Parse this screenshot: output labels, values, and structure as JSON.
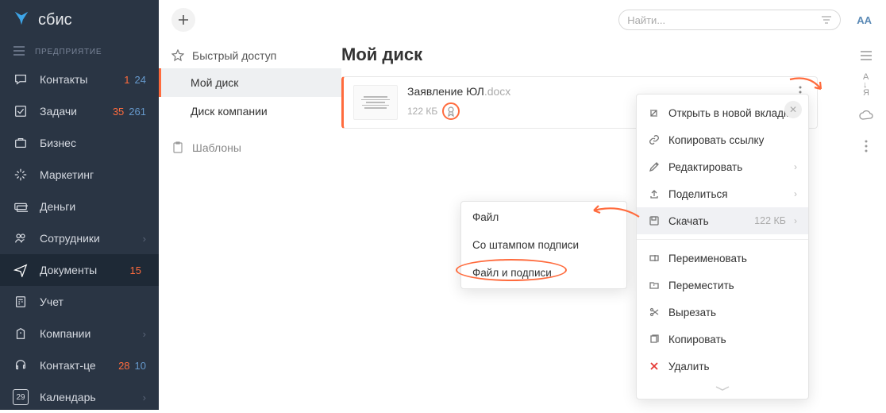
{
  "brand": "сбис",
  "enterprise": "ПРЕДПРИЯТИЕ",
  "nav": [
    {
      "label": "Контакты",
      "b1": "1",
      "b2": "24"
    },
    {
      "label": "Задачи",
      "b1": "35",
      "b2": "261"
    },
    {
      "label": "Бизнес"
    },
    {
      "label": "Маркетинг"
    },
    {
      "label": "Деньги"
    },
    {
      "label": "Сотрудники",
      "chev": true
    },
    {
      "label": "Документы",
      "b1": "15",
      "active": true
    },
    {
      "label": "Учет"
    },
    {
      "label": "Компании",
      "chev": true
    },
    {
      "label": "Контакт-це",
      "b1": "28",
      "b2": "10"
    },
    {
      "label": "Календарь",
      "chev": true
    }
  ],
  "search_placeholder": "Найти...",
  "font_size_label": "AA",
  "quick_access": "Быстрый доступ",
  "tree": {
    "my_disk": "Мой диск",
    "company_disk": "Диск компании"
  },
  "templates": "Шаблоны",
  "page_title": "Мой диск",
  "file": {
    "name": "Заявление ЮЛ",
    "ext": ".docx",
    "size": "122 КБ"
  },
  "context_menu": [
    {
      "icon": "open",
      "label": "Открыть в новой вкладке"
    },
    {
      "icon": "link",
      "label": "Копировать ссылку"
    },
    {
      "icon": "edit",
      "label": "Редактировать",
      "arrow": true
    },
    {
      "icon": "share",
      "label": "Поделиться",
      "arrow": true
    },
    {
      "icon": "download",
      "label": "Скачать",
      "size": "122 КБ",
      "arrow": true,
      "highlight": true
    },
    {
      "sep": true
    },
    {
      "icon": "rename",
      "label": "Переименовать"
    },
    {
      "icon": "move",
      "label": "Переместить"
    },
    {
      "icon": "cut",
      "label": "Вырезать"
    },
    {
      "icon": "copy",
      "label": "Копировать"
    },
    {
      "icon": "delete",
      "label": "Удалить",
      "del": true
    }
  ],
  "sub_menu": [
    "Файл",
    "Со штампом подписи",
    "Файл и подписи"
  ],
  "calendar_day": "29"
}
